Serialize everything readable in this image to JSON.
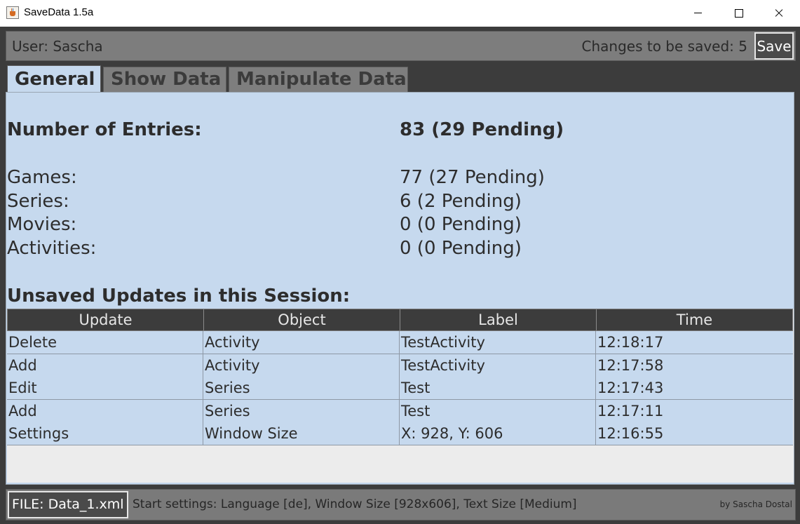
{
  "window": {
    "title": "SaveData 1.5a"
  },
  "topbar": {
    "user": "User: Sascha",
    "changes": "Changes to be saved: 5",
    "save_label": "Save"
  },
  "tabs": [
    {
      "label": "General",
      "active": true
    },
    {
      "label": "Show Data",
      "active": false
    },
    {
      "label": "Manipulate Data",
      "active": false
    }
  ],
  "general": {
    "entries_label": "Number of Entries:",
    "entries_value": "83 (29 Pending)",
    "stats": [
      {
        "label": "Games:",
        "value": "77 (27 Pending)"
      },
      {
        "label": "Series:",
        "value": "6 (2 Pending)"
      },
      {
        "label": "Movies:",
        "value": "0 (0 Pending)"
      },
      {
        "label": "Activities:",
        "value": "0 (0 Pending)"
      }
    ],
    "updates_heading": "Unsaved Updates in this Session:"
  },
  "updates_table": {
    "columns": [
      "Update",
      "Object",
      "Label",
      "Time"
    ],
    "rows": [
      [
        "Delete",
        "Activity",
        "TestActivity",
        "12:18:17"
      ],
      [
        "Add",
        "Activity",
        "TestActivity",
        "12:17:58"
      ],
      [
        "Edit",
        "Series",
        "Test",
        "12:17:43"
      ],
      [
        "Add",
        "Series",
        "Test",
        "12:17:11"
      ],
      [
        "Settings",
        "Window Size",
        "X: 928, Y: 606",
        "12:16:55"
      ]
    ]
  },
  "statusbar": {
    "file": "FILE: Data_1.xml",
    "start_settings": "Start settings: Language [de], Window Size [928x606], Text Size [Medium]",
    "author": "by Sascha Dostal"
  },
  "colors": {
    "panel_bg": "#c6d9ee",
    "frame_bg": "#3c3c3c",
    "bar_bg": "#7d7d7d",
    "header_bg": "#3c3c3c"
  }
}
